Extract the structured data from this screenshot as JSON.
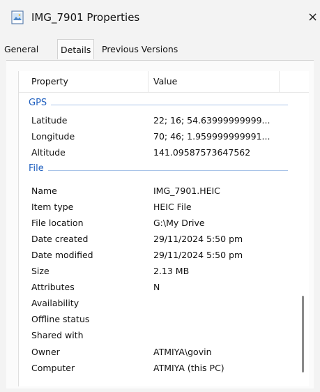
{
  "window": {
    "title": "IMG_7901 Properties",
    "close_glyph": "×"
  },
  "tabs": [
    {
      "label": "General",
      "active": false
    },
    {
      "label": "Details",
      "active": true
    },
    {
      "label": "Previous Versions",
      "active": false
    }
  ],
  "table": {
    "headers": {
      "property": "Property",
      "value": "Value"
    },
    "groups": [
      {
        "label": "GPS",
        "rows": [
          {
            "property": "Latitude",
            "value": "22; 16; 54.63999999999..."
          },
          {
            "property": "Longitude",
            "value": "70; 46; 1.959999999991..."
          },
          {
            "property": "Altitude",
            "value": "141.09587573647562"
          }
        ]
      },
      {
        "label": "File",
        "rows": [
          {
            "property": "Name",
            "value": "IMG_7901.HEIC"
          },
          {
            "property": "Item type",
            "value": "HEIC File"
          },
          {
            "property": "File location",
            "value": "G:\\My Drive"
          },
          {
            "property": "Date created",
            "value": "29/11/2024 5:50 pm"
          },
          {
            "property": "Date modified",
            "value": "29/11/2024 5:50 pm"
          },
          {
            "property": "Size",
            "value": "2.13 MB"
          },
          {
            "property": "Attributes",
            "value": "N"
          },
          {
            "property": "Availability",
            "value": ""
          },
          {
            "property": "Offline status",
            "value": ""
          },
          {
            "property": "Shared with",
            "value": ""
          },
          {
            "property": "Owner",
            "value": "ATMIYA\\govin"
          },
          {
            "property": "Computer",
            "value": "ATMIYA (this PC)"
          }
        ]
      }
    ]
  },
  "colors": {
    "group_label": "#1f5fbf",
    "group_line": "#a8c4e8"
  }
}
